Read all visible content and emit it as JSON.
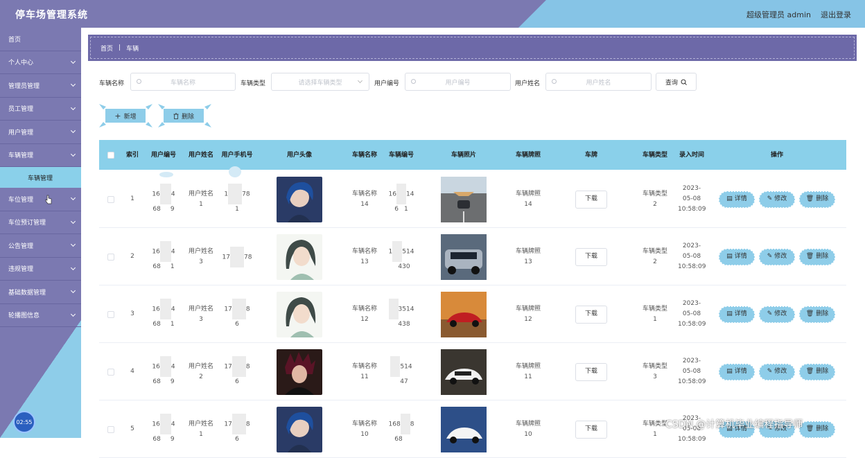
{
  "header": {
    "title": "停车场管理系统",
    "user": "超级管理员 admin",
    "logout": "退出登录"
  },
  "sidebar": {
    "items": [
      {
        "label": "首页",
        "chevron": false
      },
      {
        "label": "个人中心",
        "chevron": true
      },
      {
        "label": "管理员管理",
        "chevron": true
      },
      {
        "label": "员工管理",
        "chevron": true
      },
      {
        "label": "用户管理",
        "chevron": true
      },
      {
        "label": "车辆管理",
        "chevron": true
      }
    ],
    "subitem": "车辆管理",
    "items_after": [
      {
        "label": "车位管理",
        "chevron": true
      },
      {
        "label": "车位预订管理",
        "chevron": true
      },
      {
        "label": "公告管理",
        "chevron": true
      },
      {
        "label": "违规管理",
        "chevron": true
      },
      {
        "label": "基础数据管理",
        "chevron": true
      },
      {
        "label": "轮播图信息",
        "chevron": true
      }
    ],
    "clock": "02:55"
  },
  "breadcrumb": {
    "home": "首页",
    "sep": "|",
    "current": "车辆"
  },
  "search": {
    "vehicle_name_label": "车辆名称",
    "vehicle_name_placeholder": "车辆名称",
    "vehicle_type_label": "车辆类型",
    "vehicle_type_placeholder": "请选择车辆类型",
    "user_no_label": "用户编号",
    "user_no_placeholder": "用户编号",
    "user_name_label": "用户姓名",
    "user_name_placeholder": "用户姓名",
    "query_label": "查询"
  },
  "actions": {
    "add": "新增",
    "delete": "删除"
  },
  "table": {
    "headers": [
      "索引",
      "用户编号",
      "用户姓名",
      "用户手机号",
      "用户头像",
      "车辆名称",
      "车辆编号",
      "车辆照片",
      "车辆牌照",
      "车牌",
      "车辆类型",
      "录入时间",
      "操作"
    ],
    "download_label": "下载",
    "op_detail": "详情",
    "op_edit": "修改",
    "op_delete": "删除",
    "rows": [
      {
        "index": "1",
        "user_no_a": "16",
        "user_no_b": "4",
        "user_no_c": "68",
        "user_no_d": "9",
        "user_name": "用户姓名1",
        "phone_a": "1",
        "phone_b": "78",
        "phone_c": "1",
        "vehicle_name": "车辆名称14",
        "vehicle_no_a": "16",
        "vehicle_no_b": "14",
        "vehicle_no_c": "6",
        "vehicle_no_d": "1",
        "plate": "车辆牌照14",
        "type": "车辆类型2",
        "time": "2023-05-08 10:58:09",
        "avatar": "blue-hair",
        "car": "road-car"
      },
      {
        "index": "2",
        "user_no_a": "16",
        "user_no_b": "4",
        "user_no_c": "68",
        "user_no_d": "1",
        "user_name": "用户姓名3",
        "phone_a": "17",
        "phone_b": "78",
        "phone_c": "",
        "vehicle_name": "车辆名称13",
        "vehicle_no_a": "1",
        "vehicle_no_b": "514",
        "vehicle_no_c": "",
        "vehicle_no_d": "430",
        "plate": "车辆牌照13",
        "type": "车辆类型2",
        "time": "2023-05-08 10:58:09",
        "avatar": "green-girl",
        "car": "silver-suv"
      },
      {
        "index": "3",
        "user_no_a": "16",
        "user_no_b": "4",
        "user_no_c": "68",
        "user_no_d": "1",
        "user_name": "用户姓名3",
        "phone_a": "17",
        "phone_b": "8",
        "phone_c": "6",
        "vehicle_name": "车辆名称12",
        "vehicle_no_a": "",
        "vehicle_no_b": "3514",
        "vehicle_no_c": "",
        "vehicle_no_d": "438",
        "plate": "车辆牌照12",
        "type": "车辆类型1",
        "time": "2023-05-08 10:58:09",
        "avatar": "green-girl",
        "car": "red-car"
      },
      {
        "index": "4",
        "user_no_a": "16",
        "user_no_b": "4",
        "user_no_c": "68",
        "user_no_d": "9",
        "user_name": "用户姓名2",
        "phone_a": "17",
        "phone_b": "8",
        "phone_c": "6",
        "vehicle_name": "车辆名称11",
        "vehicle_no_a": "",
        "vehicle_no_b": "514",
        "vehicle_no_c": "",
        "vehicle_no_d": "47",
        "plate": "车辆牌照11",
        "type": "车辆类型3",
        "time": "2023-05-08 10:58:09",
        "avatar": "red-hair",
        "car": "white-car"
      },
      {
        "index": "5",
        "user_no_a": "16",
        "user_no_b": "4",
        "user_no_c": "68",
        "user_no_d": "9",
        "user_name": "用户姓名1",
        "phone_a": "17",
        "phone_b": "8",
        "phone_c": "6",
        "vehicle_name": "车辆名称10",
        "vehicle_no_a": "168",
        "vehicle_no_b": "8",
        "vehicle_no_c": "68",
        "vehicle_no_d": "",
        "plate": "车辆牌照10",
        "type": "车辆类型1",
        "time": "2023-05-08 10:58:09",
        "avatar": "blue-hair",
        "car": "white-sedan"
      }
    ]
  },
  "watermark": "CSDN @计算机毕业编程指导师"
}
